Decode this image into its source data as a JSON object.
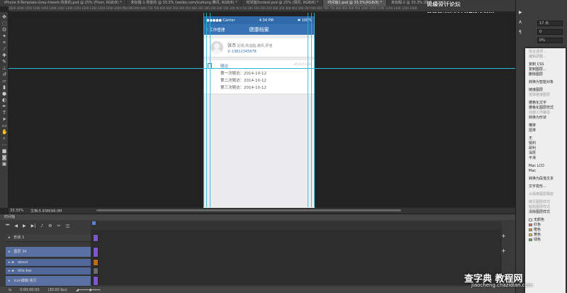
{
  "tabs": [
    {
      "label": "iPhone 6-Template-Grey-hiwork-恢复的.psd @ 25% (Floor, RGB/8) *",
      "active": false
    },
    {
      "label": "未标题-1-恢复的 @ 33.3% (weibo.com/tcahung 腾讯, RGB/8) *",
      "active": false
    },
    {
      "label": "时间轴3cntest.psd @ 25% (阴历, RGB/8) *",
      "active": false
    },
    {
      "label": "时间轴1.psd @ 33.3%(RGB/8) *",
      "active": true
    },
    {
      "label": "未标题-2 @ 33.3% (描述, RGB/8) *",
      "active": false
    }
  ],
  "watermark_top": "思缘设计论坛 www.MISSYUAN.COM",
  "ruler_text": "1650 1600 1550 1500 1450 1400 1350 1300 1250 1200 1150 1100 1050 1000 950 900 850 800 750 700 650 600 550 500 450 400 350 300 250 200 150 100 50 0 50 100 150 200 250 300 350 400 450 500 550 600 650 700 750 800 850 900 950 1000 1050 1100 1150 1200 1250 1300",
  "phone": {
    "status": {
      "carrier": "Carrier",
      "time": "4:34 PM",
      "battery": "100%"
    },
    "nav": {
      "back": "工作管理",
      "title": "健康档案"
    },
    "profile": {
      "name": "张杰",
      "tags": "近视,高血脂,痛风,肝癌",
      "phone": "13812345678"
    },
    "visit": {
      "title": "随访",
      "date": "2014/11/26",
      "lines": [
        "第一次随访：2014-10-12",
        "第二次随访：2014-10-12",
        "第三次随访：2014-10-12"
      ]
    }
  },
  "infobar": {
    "zoom": "33.33%",
    "doc": "文档:5.93M/98.0M"
  },
  "right_panel": {
    "font_size": "17 点",
    "leading": "0",
    "tracking": "0%"
  },
  "menu_items": [
    {
      "label": "混合选项...",
      "enabled": false
    },
    {
      "label": "编辑调整...",
      "enabled": false
    },
    {
      "sep": true
    },
    {
      "label": "复制 CSS",
      "enabled": true
    },
    {
      "label": "复制图层...",
      "enabled": true
    },
    {
      "label": "删除图层",
      "enabled": true
    },
    {
      "sep": true
    },
    {
      "label": "转换为智能对象",
      "enabled": true
    },
    {
      "sep": true
    },
    {
      "label": "链接图层",
      "enabled": true
    },
    {
      "label": "选择链接图层",
      "enabled": false
    },
    {
      "sep": true
    },
    {
      "label": "栅格化文字",
      "enabled": true
    },
    {
      "label": "栅格化图层样式",
      "enabled": true
    },
    {
      "label": "创建工作路径",
      "enabled": false
    },
    {
      "label": "转换为形状",
      "enabled": true
    },
    {
      "sep": true
    },
    {
      "label": "横排",
      "enabled": true
    },
    {
      "label": "竖排",
      "enabled": true
    },
    {
      "sep": true
    },
    {
      "label": "无",
      "enabled": true
    },
    {
      "label": "锐利",
      "enabled": true
    },
    {
      "label": "犀利",
      "enabled": true
    },
    {
      "label": "浑厚",
      "enabled": true
    },
    {
      "label": "平滑",
      "enabled": true
    },
    {
      "sep": true
    },
    {
      "label": "Mac LCD",
      "enabled": true
    },
    {
      "label": "Mac",
      "enabled": true
    },
    {
      "sep": true
    },
    {
      "label": "转换为段落文本",
      "enabled": true
    },
    {
      "sep": true
    },
    {
      "label": "文字变形...",
      "enabled": true
    },
    {
      "sep": true
    },
    {
      "label": "从隔离图层释放",
      "enabled": false
    },
    {
      "sep": true
    },
    {
      "label": "拷贝图层样式",
      "enabled": false
    },
    {
      "label": "粘贴图层样式",
      "enabled": false
    },
    {
      "label": "清除图层样式",
      "enabled": true
    },
    {
      "sep": true
    },
    {
      "label": "无颜色",
      "enabled": true,
      "color": "#ffffff"
    },
    {
      "label": "红色",
      "enabled": true,
      "color": "#e06666"
    },
    {
      "label": "橙色",
      "enabled": true,
      "color": "#e69138"
    },
    {
      "label": "黄色",
      "enabled": true,
      "color": "#f1c232"
    },
    {
      "label": "绿色",
      "enabled": true,
      "color": "#6aa84f"
    }
  ],
  "timeline": {
    "title": "时间轴",
    "layers": [
      {
        "name": "形状 1",
        "kind": "normal",
        "clip_color": "#7c58c8"
      },
      {
        "name": "图层 34",
        "kind": "sel",
        "clip_color": "#7c58c8"
      },
      {
        "name": "about",
        "kind": "blue",
        "clip_color": "#c06a1e"
      },
      {
        "name": "title-bar",
        "kind": "blue",
        "clip_color": "#6b6b6b"
      },
      {
        "name": "icon模糊 拷贝",
        "kind": "sel",
        "clip_color": "#7c58c8"
      }
    ],
    "timecode": "0:00:00:00",
    "fps": "(30.00 fps)"
  },
  "watermark_bottom": {
    "main": "查字典 教程网",
    "url": "jiaocheng.chazidian.com"
  }
}
